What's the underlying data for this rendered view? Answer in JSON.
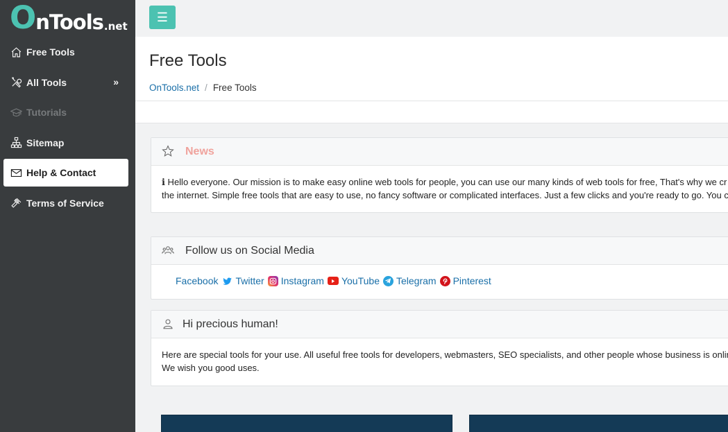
{
  "brand": {
    "o": "O",
    "rest": "nTools",
    "net": ".net"
  },
  "sidebar": {
    "items": [
      {
        "label": "Free Tools",
        "icon": "home-icon"
      },
      {
        "label": "All Tools",
        "icon": "tools-icon",
        "chevron": "»"
      },
      {
        "label": "Tutorials",
        "icon": "graduation-cap-icon",
        "disabled": true
      },
      {
        "label": "Sitemap",
        "icon": "sitemap-icon"
      },
      {
        "label": "Help & Contact",
        "icon": "envelope-icon",
        "active": true
      },
      {
        "label": "Terms of Service",
        "icon": "gavel-icon"
      }
    ]
  },
  "topbar": {
    "menu_icon": "☰"
  },
  "header": {
    "title": "Free Tools",
    "breadcrumb": {
      "home": "OnTools.net",
      "sep": "/",
      "current": "Free Tools"
    }
  },
  "news": {
    "title": "News",
    "line1": "ℹ Hello everyone. Our mission is to make easy online web tools for people, you can use our many kinds of web tools for free, That's why we cr",
    "line2": "the internet. Simple free tools that are easy to use, no fancy software or complicated interfaces. Just a few clicks and you're ready to go. You c"
  },
  "social": {
    "title": "Follow us on Social Media",
    "links": {
      "facebook": "Facebook",
      "twitter": "Twitter",
      "instagram": "Instagram",
      "youtube": "YouTube",
      "telegram": "Telegram",
      "pinterest": "Pinterest"
    }
  },
  "human": {
    "title": "Hi precious human!",
    "line1": "Here are special tools for your use. All useful free tools for developers, webmasters, SEO specialists, and other people whose business is onlin",
    "line2": "We wish you good uses."
  },
  "colors": {
    "accent": "#4cc2b1",
    "sidebar": "#393c3e",
    "link": "#1a6fa8",
    "news_title": "#f0a39d",
    "dark_block": "#143a56"
  }
}
